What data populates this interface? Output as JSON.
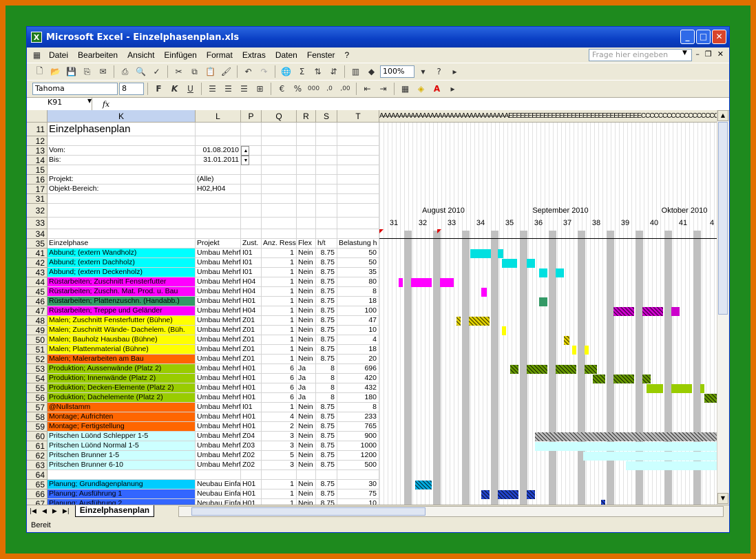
{
  "window": {
    "title": "Microsoft Excel - Einzelphasenplan.xls",
    "app_icon": "excel-icon"
  },
  "menu": [
    "Datei",
    "Bearbeiten",
    "Ansicht",
    "Einfügen",
    "Format",
    "Extras",
    "Daten",
    "Fenster",
    "?"
  ],
  "help_placeholder": "Frage hier eingeben",
  "format_toolbar": {
    "font": "Tahoma",
    "size": "8",
    "zoom": "100%"
  },
  "namebox": "K91",
  "fx_label": "fx",
  "columns": [
    "K",
    "L",
    "P",
    "Q",
    "R",
    "S",
    "T"
  ],
  "gantt_header_text": "AAAAAAAAAAAAAAAAAAAAAAAAAAAAAAAAAEEEEEEEEEEEEEEEEEEEEEEEEEEEEEEEEEECCCCCCCCCCCCCCCCCCCCCCCCCCCCCCCCCC",
  "sheet": {
    "title": "Einzelphasenplan",
    "vom_label": "Vom:",
    "vom": "01.08.2010",
    "bis_label": "Bis:",
    "bis": "31.01.2011",
    "projekt_label": "Projekt:",
    "projekt": "(Alle)",
    "objekt_label": "Objekt-Bereich:",
    "objekt": "H02,H04",
    "months": [
      "August 2010",
      "September 2010",
      "Oktober 2010"
    ],
    "weeks": [
      "31",
      "32",
      "33",
      "34",
      "35",
      "36",
      "37",
      "38",
      "39",
      "40",
      "41",
      "4"
    ],
    "headers": [
      "Einzelphase",
      "Projekt",
      "Zust.",
      "Anz. Ress",
      "Flex",
      "h/t",
      "Belastung h"
    ],
    "rows": [
      {
        "n": "41",
        "name": "Abbund; (extern Wandholz)",
        "proj": "Umbau Mehrf",
        "zust": "I01",
        "anz": "1",
        "flex": "Nein",
        "ht": "8.75",
        "bel": "50",
        "color": "#00ffff"
      },
      {
        "n": "42",
        "name": "Abbund; (extern Dachholz)",
        "proj": "Umbau Mehrf",
        "zust": "I01",
        "anz": "1",
        "flex": "Nein",
        "ht": "8.75",
        "bel": "50",
        "color": "#00ffff"
      },
      {
        "n": "43",
        "name": "Abbund; (extern Deckenholz)",
        "proj": "Umbau Mehrf",
        "zust": "I01",
        "anz": "1",
        "flex": "Nein",
        "ht": "8.75",
        "bel": "35",
        "color": "#00ffff"
      },
      {
        "n": "44",
        "name": "Rüstarbeiten; Zuschnitt Fensterfutter",
        "proj": "Umbau Mehrf",
        "zust": "H04",
        "anz": "1",
        "flex": "Nein",
        "ht": "8.75",
        "bel": "80",
        "color": "#ff00ff"
      },
      {
        "n": "45",
        "name": "Rüstarbeiten; Zuschn. Mat. Prod. u. Bau",
        "proj": "Umbau Mehrf",
        "zust": "H04",
        "anz": "1",
        "flex": "Nein",
        "ht": "8.75",
        "bel": "8",
        "color": "#ff00ff"
      },
      {
        "n": "46",
        "name": "Rüstarbeiten; Plattenzuschn. (Handabb.)",
        "proj": "Umbau Mehrf",
        "zust": "H01",
        "anz": "1",
        "flex": "Nein",
        "ht": "8.75",
        "bel": "18",
        "color": "#339966"
      },
      {
        "n": "47",
        "name": "Rüstarbeiten; Treppe und Geländer",
        "proj": "Umbau Mehrf",
        "zust": "H04",
        "anz": "1",
        "flex": "Nein",
        "ht": "8.75",
        "bel": "100",
        "color": "#ff00ff"
      },
      {
        "n": "48",
        "name": "Malen; Zuschnitt Fensterfutter (Bühne)",
        "proj": "Umbau Mehrf",
        "zust": "Z01",
        "anz": "1",
        "flex": "Nein",
        "ht": "8.75",
        "bel": "47",
        "color": "#ffff00"
      },
      {
        "n": "49",
        "name": "Malen; Zuschnitt Wände- Dachelem. (Büh.",
        "proj": "Umbau Mehrf",
        "zust": "Z01",
        "anz": "1",
        "flex": "Nein",
        "ht": "8.75",
        "bel": "10",
        "color": "#ffff00"
      },
      {
        "n": "50",
        "name": "Malen; Bauholz Hausbau (Bühne)",
        "proj": "Umbau Mehrf",
        "zust": "Z01",
        "anz": "1",
        "flex": "Nein",
        "ht": "8.75",
        "bel": "4",
        "color": "#ffff00"
      },
      {
        "n": "51",
        "name": "Malen; Plattenmaterial (Bühne)",
        "proj": "Umbau Mehrf",
        "zust": "Z01",
        "anz": "1",
        "flex": "Nein",
        "ht": "8.75",
        "bel": "18",
        "color": "#ffff00"
      },
      {
        "n": "52",
        "name": "Malen; Malerarbeiten am Bau",
        "proj": "Umbau Mehrf",
        "zust": "Z01",
        "anz": "1",
        "flex": "Nein",
        "ht": "8.75",
        "bel": "20",
        "color": "#ff6600"
      },
      {
        "n": "53",
        "name": "Produktion; Aussenwände (Platz 2)",
        "proj": "Umbau Mehrf",
        "zust": "H01",
        "anz": "6",
        "flex": "Ja",
        "ht": "8",
        "bel": "696",
        "color": "#99cc00"
      },
      {
        "n": "54",
        "name": "Produktion; Innenwände (Platz 2)",
        "proj": "Umbau Mehrf",
        "zust": "H01",
        "anz": "6",
        "flex": "Ja",
        "ht": "8",
        "bel": "420",
        "color": "#99cc00"
      },
      {
        "n": "55",
        "name": "Produktion; Decken-Elemente (Platz 2)",
        "proj": "Umbau Mehrf",
        "zust": "H01",
        "anz": "6",
        "flex": "Ja",
        "ht": "8",
        "bel": "432",
        "color": "#99cc00"
      },
      {
        "n": "56",
        "name": "Produktion; Dachelemente (Platz 2)",
        "proj": "Umbau Mehrf",
        "zust": "H01",
        "anz": "6",
        "flex": "Ja",
        "ht": "8",
        "bel": "180",
        "color": "#99cc00"
      },
      {
        "n": "57",
        "name": "@Nullstamm",
        "proj": "Umbau Mehrf",
        "zust": "I01",
        "anz": "1",
        "flex": "Nein",
        "ht": "8.75",
        "bel": "8",
        "color": "#ff6600"
      },
      {
        "n": "58",
        "name": "Montage; Aufrichten",
        "proj": "Umbau Mehrf",
        "zust": "H01",
        "anz": "4",
        "flex": "Nein",
        "ht": "8.75",
        "bel": "233",
        "color": "#ff6600"
      },
      {
        "n": "59",
        "name": "Montage; Fertigstellung",
        "proj": "Umbau Mehrf",
        "zust": "H01",
        "anz": "2",
        "flex": "Nein",
        "ht": "8.75",
        "bel": "765",
        "color": "#ff6600"
      },
      {
        "n": "60",
        "name": "Pritschen Lüönd Schlepper 1-5",
        "proj": "Umbau Mehrf",
        "zust": "Z04",
        "anz": "3",
        "flex": "Nein",
        "ht": "8.75",
        "bel": "900",
        "color": "#ccffff"
      },
      {
        "n": "61",
        "name": "Pritschen Lüönd Normal 1-5",
        "proj": "Umbau Mehrf",
        "zust": "Z03",
        "anz": "3",
        "flex": "Nein",
        "ht": "8.75",
        "bel": "1000",
        "color": "#ccffff"
      },
      {
        "n": "62",
        "name": "Pritschen Brunner 1-5",
        "proj": "Umbau Mehrf",
        "zust": "Z02",
        "anz": "5",
        "flex": "Nein",
        "ht": "8.75",
        "bel": "1200",
        "color": "#ccffff"
      },
      {
        "n": "63",
        "name": "Pritschen Brunner 6-10",
        "proj": "Umbau Mehrf",
        "zust": "Z02",
        "anz": "3",
        "flex": "Nein",
        "ht": "8.75",
        "bel": "500",
        "color": "#ccffff"
      },
      {
        "n": "64",
        "name": "",
        "proj": "",
        "zust": "",
        "anz": "",
        "flex": "",
        "ht": "",
        "bel": "",
        "color": "#ffffff"
      },
      {
        "n": "65",
        "name": "Planung; Grundlagenplanung",
        "proj": "Neubau Einfa",
        "zust": "H01",
        "anz": "1",
        "flex": "Nein",
        "ht": "8.75",
        "bel": "30",
        "color": "#00ccff"
      },
      {
        "n": "66",
        "name": "Planung; Ausführung 1",
        "proj": "Neubau Einfa",
        "zust": "H01",
        "anz": "1",
        "flex": "Nein",
        "ht": "8.75",
        "bel": "75",
        "color": "#3366ff"
      },
      {
        "n": "67",
        "name": "Planung; Ausführung 2",
        "proj": "Neubau Einfa",
        "zust": "H01",
        "anz": "1",
        "flex": "Nein",
        "ht": "8.75",
        "bel": "10",
        "color": "#3366ff"
      }
    ]
  },
  "sheet_tab": "Einzelphasenplan",
  "status": "Bereit"
}
